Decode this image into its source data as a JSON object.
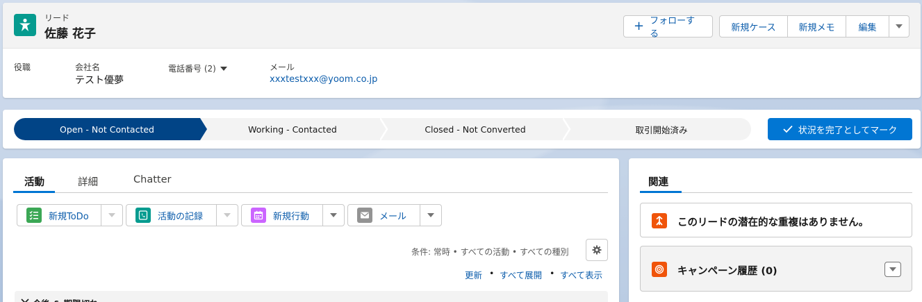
{
  "colors": {
    "brand_blue": "#0176d3",
    "active_stage": "#014486",
    "link": "#0b5cab",
    "lead_icon": "#069b8f",
    "orange_icon": "#f0540a"
  },
  "header": {
    "object_label": "リード",
    "record_name": "佐藤 花子",
    "icon": "lead-icon",
    "buttons": {
      "follow": "フォローする",
      "new_case": "新規ケース",
      "new_note": "新規メモ",
      "edit": "編集"
    },
    "fields": {
      "title_label": "役職",
      "company_label": "会社名",
      "company_value": "テスト優夢",
      "phone_label": "電話番号 (2)",
      "email_label": "メール",
      "email_value": "xxxtestxxx@yoom.co.jp"
    }
  },
  "path": {
    "stages": [
      {
        "label": "Open - Not Contacted",
        "active": true
      },
      {
        "label": "Working - Contacted",
        "active": false
      },
      {
        "label": "Closed - Not Converted",
        "active": false
      },
      {
        "label": "取引開始済み",
        "active": false
      }
    ],
    "mark_button": "状況を完了としてマーク"
  },
  "activity": {
    "tabs": [
      "活動",
      "詳細",
      "Chatter"
    ],
    "actions": [
      {
        "label": "新規ToDo",
        "icon": "task-icon",
        "color": "#3ba755"
      },
      {
        "label": "活動の記録",
        "icon": "call-log-icon",
        "color": "#069b8f"
      },
      {
        "label": "新規行動",
        "icon": "calendar-icon",
        "color": "#cb65ff"
      },
      {
        "label": "メール",
        "icon": "email-icon",
        "color": "#939393"
      }
    ],
    "filter_text": "条件: 常時 • すべての活動 • すべての種別",
    "links": {
      "refresh": "更新",
      "expand_all": "すべて展開",
      "show_all": "すべて表示",
      "separator": "•"
    },
    "upcoming_label": "今後 & 期限切れ"
  },
  "related": {
    "tab": "関連",
    "duplicates_text": "このリードの潜在的な重複はありません。",
    "campaign_history": "キャンペーン履歴 (0)"
  }
}
